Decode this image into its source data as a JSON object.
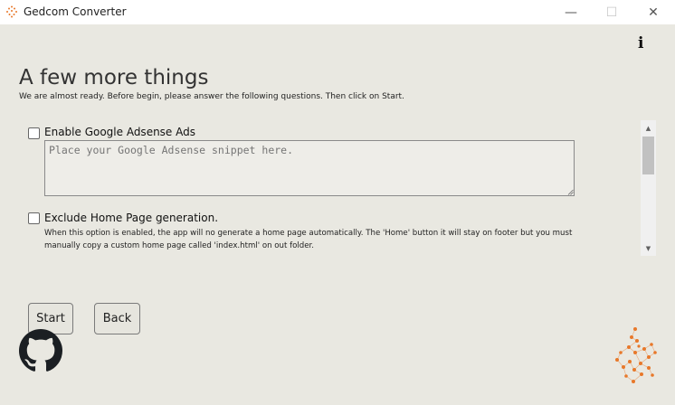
{
  "window": {
    "title": "Gedcom Converter",
    "minimize_glyph": "—",
    "maximize_glyph": "☐",
    "close_glyph": "✕"
  },
  "icons": {
    "app": "tree-dots-icon",
    "info": "info-icon",
    "github": "github-icon",
    "logo": "tree-dots-logo"
  },
  "page": {
    "heading": "A few more things",
    "subtitle": "We are almost ready. Before begin, please answer the following questions. Then click on Start."
  },
  "options": {
    "adsense": {
      "label": "Enable Google Adsense Ads",
      "checked": false,
      "placeholder": "Place your Google Adsense snippet here.",
      "value": ""
    },
    "exclude_home": {
      "label": "Exclude Home Page generation.",
      "checked": false,
      "description": "When this option is enabled, the app will no generate a home page automatically. The 'Home' button it will stay on footer but you must manually copy a custom home page called 'index.html' on out folder."
    }
  },
  "buttons": {
    "start": "Start",
    "back": "Back"
  },
  "colors": {
    "background": "#e9e8e1",
    "titlebar": "#ffffff",
    "logo_orange": "#e8782a"
  }
}
